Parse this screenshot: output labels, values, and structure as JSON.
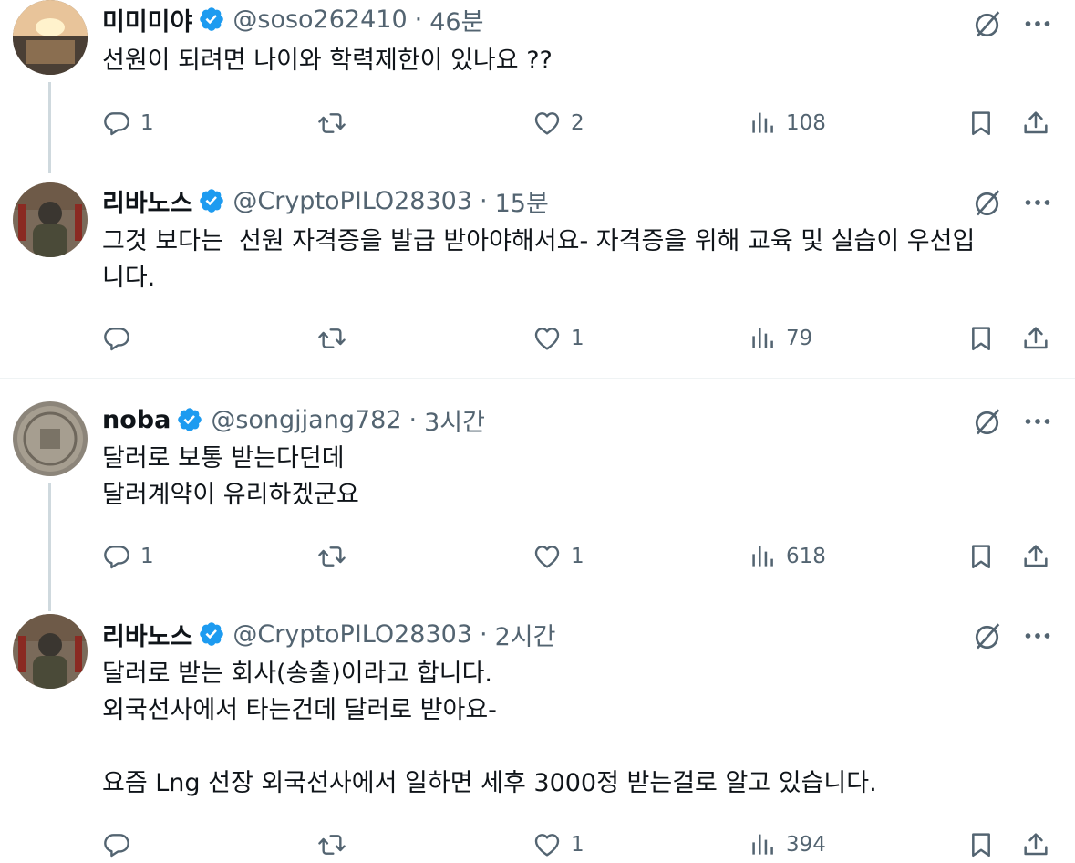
{
  "tweets": [
    {
      "name": "미미미야",
      "handle": "@soso262410",
      "sep": "·",
      "time": "46분",
      "text": "선원이 되려면 나이와 학력제한이 있나요 ??",
      "replies": "1",
      "retweets": "",
      "likes": "2",
      "views": "108"
    },
    {
      "name": "리바노스",
      "handle": "@CryptoPILO28303",
      "sep": "·",
      "time": "15분",
      "text": "그것 보다는  선원 자격증을 발급 받아야해서요- 자격증을 위해 교육 및 실습이 우선입\n니다.",
      "replies": "",
      "retweets": "",
      "likes": "1",
      "views": "79"
    },
    {
      "name": "noba",
      "handle": "@songjjang782",
      "sep": "·",
      "time": "3시간",
      "text": "달러로 보통 받는다던데\n달러계약이 유리하겠군요",
      "replies": "1",
      "retweets": "",
      "likes": "1",
      "views": "618"
    },
    {
      "name": "리바노스",
      "handle": "@CryptoPILO28303",
      "sep": "·",
      "time": "2시간",
      "text": "달러로 받는 회사(송출)이라고 합니다.\n외국선사에서 타는건데 달러로 받아요-\n\n요즘 Lng 선장 외국선사에서 일하면 세후 3000정 받는걸로 알고 있습니다.",
      "replies": "",
      "retweets": "",
      "likes": "1",
      "views": "394"
    }
  ],
  "icons": {
    "verified": "verified-badge-icon",
    "grok": "grok-icon",
    "more": "more-icon",
    "reply": "reply-icon",
    "retweet": "retweet-icon",
    "like": "like-icon",
    "views": "views-icon",
    "bookmark": "bookmark-icon",
    "share": "share-icon"
  },
  "colors": {
    "text": "#0f1419",
    "secondary": "#536471",
    "verified": "#1d9bf0",
    "divider": "#eff3f4",
    "thread_line": "#cfd9de"
  }
}
